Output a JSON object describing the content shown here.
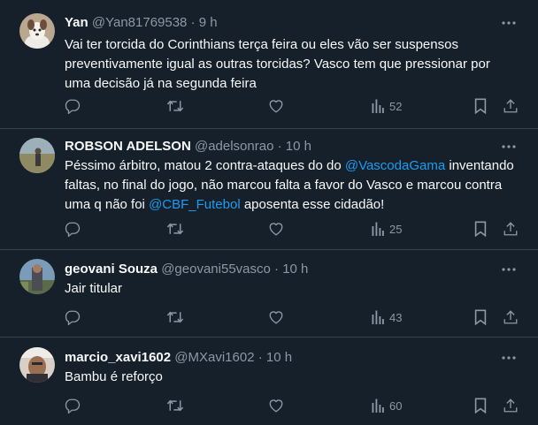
{
  "tweets": [
    {
      "name": "Yan",
      "handle": "@Yan81769538",
      "sep": "·",
      "time": "9 h",
      "text_parts": [
        {
          "text": "Vai ter torcida do Corinthians terça feira ou eles vão ser suspensos preventivamente igual as outras torcidas? Vasco tem que pressionar por uma decisão já na segunda feira"
        }
      ],
      "views": "52"
    },
    {
      "name": "ROBSON ADELSON",
      "handle": "@adelsonrao",
      "sep": "·",
      "time": "10 h",
      "text_parts": [
        {
          "text": "Péssimo árbitro, matou 2 contra-ataques do do "
        },
        {
          "text": "@VascodaGama",
          "mention": true
        },
        {
          "text": " inventando faltas, no final do jogo, não marcou falta a favor do Vasco e marcou contra uma q não foi "
        },
        {
          "text": "@CBF_Futebol",
          "mention": true
        },
        {
          "text": " aposenta esse cidadão!"
        }
      ],
      "views": "25"
    },
    {
      "name": "geovani Souza",
      "handle": "@geovani55vasco",
      "sep": "·",
      "time": "10 h",
      "text_parts": [
        {
          "text": "Jair titular"
        }
      ],
      "views": "43"
    },
    {
      "name": "marcio_xavi1602",
      "handle": "@MXavi1602",
      "sep": "·",
      "time": "10 h",
      "text_parts": [
        {
          "text": "Bambu é reforço"
        }
      ],
      "views": "60"
    }
  ],
  "icons": {
    "reply": "reply-icon",
    "retweet": "retweet-icon",
    "like": "like-icon",
    "views": "views-icon",
    "bookmark": "bookmark-icon",
    "share": "share-icon",
    "more": "more-icon"
  },
  "colors": {
    "background": "#15202b",
    "text": "#f7f9f9",
    "secondary": "#8b98a5",
    "mention": "#1d9bf0",
    "divider": "#38444d"
  }
}
